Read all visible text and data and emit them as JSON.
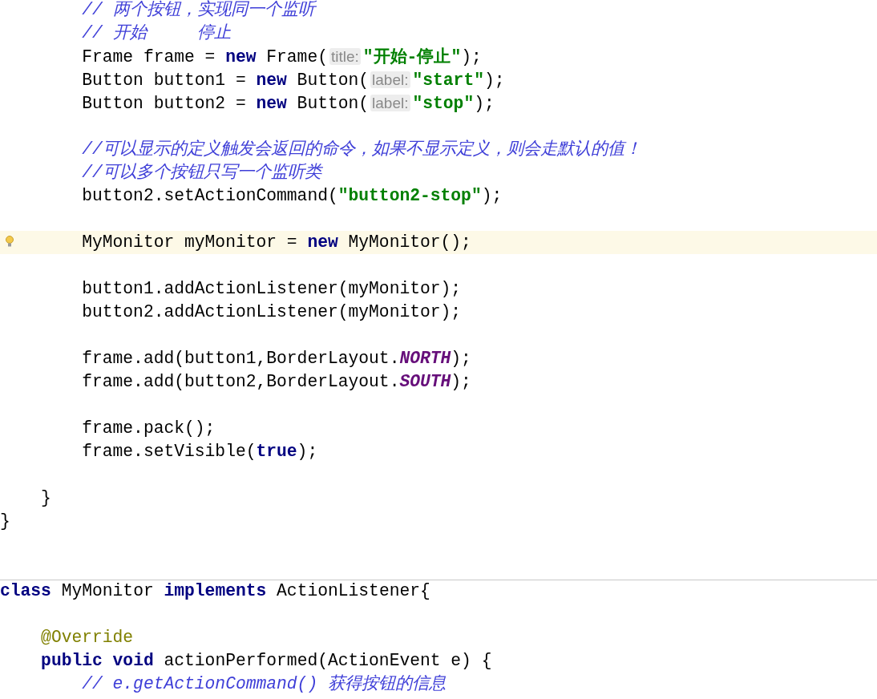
{
  "editor": {
    "lines": [
      {
        "kind": "block",
        "children": [
          {
            "kind": "block",
            "children": [
              {
                "kind": "code",
                "current": false,
                "segments": [
                  {
                    "text": "// 两个按钮，实现同一个监听",
                    "kind": "comment"
                  }
                ]
              },
              {
                "kind": "code",
                "current": false,
                "segments": [
                  {
                    "text": "// 开始     停止",
                    "kind": "comment"
                  }
                ]
              },
              {
                "kind": "code",
                "current": false,
                "segments": [
                  {
                    "text": "Frame frame = ",
                    "kind": "plain"
                  },
                  {
                    "text": "new",
                    "kind": "keyword"
                  },
                  {
                    "text": " Frame(",
                    "kind": "plain"
                  },
                  {
                    "text": "title:",
                    "kind": "hint"
                  },
                  {
                    "text": "\"开始-停止\"",
                    "kind": "string"
                  },
                  {
                    "text": ");",
                    "kind": "plain"
                  }
                ]
              },
              {
                "kind": "code",
                "current": false,
                "segments": [
                  {
                    "text": "Button button1 = ",
                    "kind": "plain"
                  },
                  {
                    "text": "new",
                    "kind": "keyword"
                  },
                  {
                    "text": " Button(",
                    "kind": "plain"
                  },
                  {
                    "text": "label:",
                    "kind": "hint"
                  },
                  {
                    "text": "\"start\"",
                    "kind": "string"
                  },
                  {
                    "text": ");",
                    "kind": "plain"
                  }
                ]
              },
              {
                "kind": "code",
                "current": false,
                "segments": [
                  {
                    "text": "Button button2 = ",
                    "kind": "plain"
                  },
                  {
                    "text": "new",
                    "kind": "keyword"
                  },
                  {
                    "text": " Button(",
                    "kind": "plain"
                  },
                  {
                    "text": "label:",
                    "kind": "hint"
                  },
                  {
                    "text": "\"stop\"",
                    "kind": "string"
                  },
                  {
                    "text": ");",
                    "kind": "plain"
                  }
                ]
              },
              {
                "kind": "blank"
              },
              {
                "kind": "code",
                "current": false,
                "segments": [
                  {
                    "text": "//可以显示的定义触发会返回的命令，如果不显示定义，则会走默认的值！",
                    "kind": "comment"
                  }
                ]
              },
              {
                "kind": "code",
                "current": false,
                "segments": [
                  {
                    "text": "//可以多个按钮只写一个监听类",
                    "kind": "comment"
                  }
                ]
              },
              {
                "kind": "code",
                "current": false,
                "segments": [
                  {
                    "text": "button2.setActionCommand(",
                    "kind": "plain"
                  },
                  {
                    "text": "\"button2-stop\"",
                    "kind": "string"
                  },
                  {
                    "text": ");",
                    "kind": "plain"
                  }
                ]
              },
              {
                "kind": "blank"
              },
              {
                "kind": "code",
                "current": true,
                "segments": [
                  {
                    "text": "MyMonitor myMonitor = ",
                    "kind": "plain"
                  },
                  {
                    "text": "new",
                    "kind": "keyword"
                  },
                  {
                    "text": " MyMonitor();",
                    "kind": "plain"
                  }
                ]
              },
              {
                "kind": "blank"
              },
              {
                "kind": "code",
                "current": false,
                "segments": [
                  {
                    "text": "button1.addActionListener(myMonitor);",
                    "kind": "plain"
                  }
                ]
              },
              {
                "kind": "code",
                "current": false,
                "segments": [
                  {
                    "text": "button2.addActionListener(myMonitor);",
                    "kind": "plain"
                  }
                ]
              },
              {
                "kind": "blank"
              },
              {
                "kind": "code",
                "current": false,
                "segments": [
                  {
                    "text": "frame.add(button1,BorderLayout.",
                    "kind": "plain"
                  },
                  {
                    "text": "NORTH",
                    "kind": "constant"
                  },
                  {
                    "text": ");",
                    "kind": "plain"
                  }
                ]
              },
              {
                "kind": "code",
                "current": false,
                "segments": [
                  {
                    "text": "frame.add(button2,BorderLayout.",
                    "kind": "plain"
                  },
                  {
                    "text": "SOUTH",
                    "kind": "constant"
                  },
                  {
                    "text": ");",
                    "kind": "plain"
                  }
                ]
              },
              {
                "kind": "blank"
              },
              {
                "kind": "code",
                "current": false,
                "segments": [
                  {
                    "text": "frame.pack();",
                    "kind": "plain"
                  }
                ]
              },
              {
                "kind": "code",
                "current": false,
                "segments": [
                  {
                    "text": "frame.setVisible(",
                    "kind": "plain"
                  },
                  {
                    "text": "true",
                    "kind": "keyword"
                  },
                  {
                    "text": ");",
                    "kind": "plain"
                  }
                ]
              },
              {
                "kind": "blank"
              }
            ]
          },
          {
            "kind": "code",
            "current": false,
            "segments": [
              {
                "text": "}",
                "kind": "plain"
              }
            ]
          }
        ]
      },
      {
        "kind": "code",
        "current": false,
        "segments": [
          {
            "text": "}",
            "kind": "plain"
          }
        ]
      },
      {
        "kind": "blank"
      },
      {
        "kind": "blank"
      },
      {
        "kind": "separator"
      },
      {
        "kind": "code",
        "current": false,
        "segments": [
          {
            "text": "class",
            "kind": "keyword"
          },
          {
            "text": " MyMonitor ",
            "kind": "plain"
          },
          {
            "text": "implements",
            "kind": "keyword"
          },
          {
            "text": " ActionListener{",
            "kind": "plain"
          }
        ],
        "children": [
          {
            "kind": "blank"
          },
          {
            "kind": "code",
            "current": false,
            "segments": [
              {
                "text": "@Override",
                "kind": "annotation"
              }
            ]
          },
          {
            "kind": "code",
            "current": false,
            "segments": [
              {
                "text": "public void",
                "kind": "keyword"
              },
              {
                "text": " actionPerformed(ActionEvent e) {",
                "kind": "plain"
              }
            ],
            "children": [
              {
                "kind": "code",
                "current": false,
                "segments": [
                  {
                    "text": "// e.getActionCommand() 获得按钮的信息",
                    "kind": "comment"
                  }
                ]
              }
            ]
          }
        ]
      }
    ]
  }
}
